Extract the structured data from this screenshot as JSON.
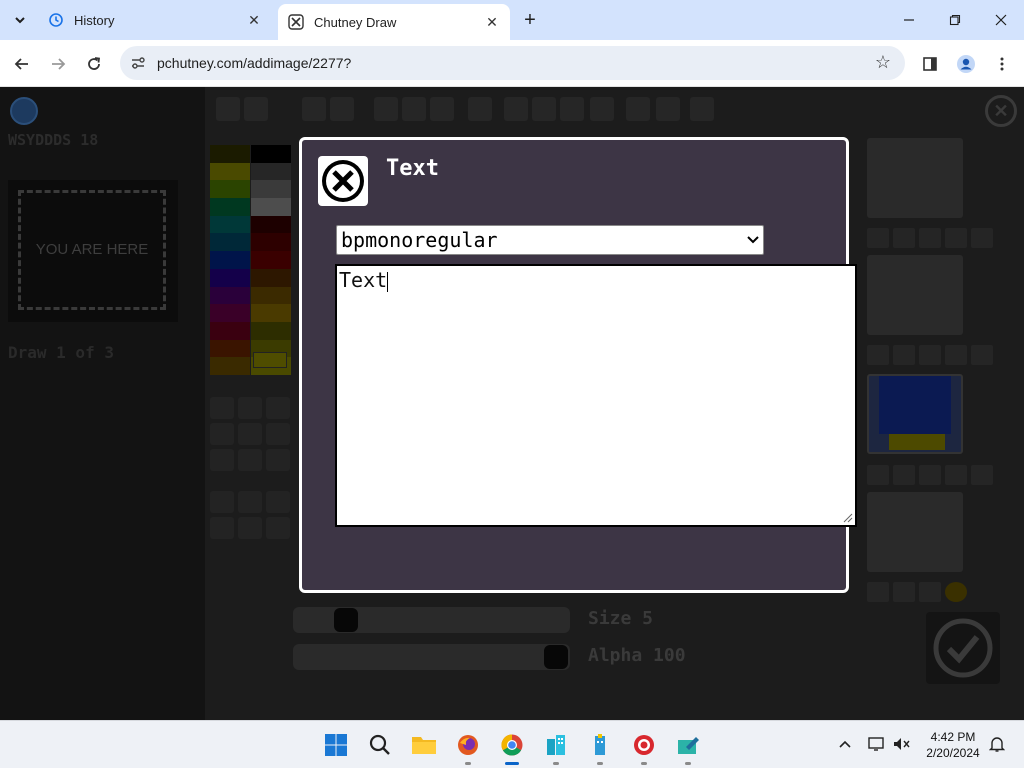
{
  "browser": {
    "tabs": [
      {
        "title": "History",
        "icon": "history-icon"
      },
      {
        "title": "Chutney Draw",
        "icon": "chutney-icon"
      }
    ],
    "url": "pchutney.com/addimage/2277?"
  },
  "app": {
    "stats_text": "WSYDDDS 18",
    "placeholder_box_text": "YOU ARE HERE",
    "draw_count_text": "Draw 1 of 3",
    "size_label": "Size 5",
    "alpha_label": "Alpha 100",
    "size_value": 5,
    "alpha_value": 100,
    "palette_left": [
      "#1b1b00",
      "#4a4a00",
      "#2b4400",
      "#003820",
      "#003838",
      "#002838",
      "#00144a",
      "#14004a",
      "#2a003a",
      "#3a0028",
      "#3a0010",
      "#3a1400",
      "#3a2a00"
    ],
    "palette_right": [
      "#000000",
      "#262626",
      "#3a3a3a",
      "#4d4d4d",
      "#1d0000",
      "#2d0000",
      "#3a0000",
      "#2d1700",
      "#3b2a00",
      "#4a3a00",
      "#2d2d00",
      "#3b3b00",
      "#4a4a00"
    ],
    "current_color": "#4f4d00"
  },
  "dialog": {
    "title": "Text",
    "font_selected": "bpmonoregular",
    "text_value": "Text"
  },
  "taskbar": {
    "time": "4:42 PM",
    "date": "2/20/2024"
  }
}
